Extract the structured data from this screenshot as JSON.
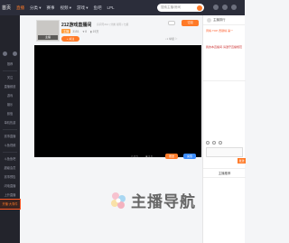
{
  "topbar": {
    "logo": "首页",
    "nav": [
      "直播",
      "分类 ▾",
      "赛事",
      "视频 ▾",
      "游戏 ▾",
      "鱼吧",
      "LPL"
    ],
    "search_placeholder": "搜索主播/房间"
  },
  "sidebar": {
    "items": [
      "推荐",
      "关注",
      "直播频道",
      "游戏",
      "娱乐",
      "颜值",
      "单机热游",
      "全部",
      "综合",
      "赛事直播",
      "斗鱼视频",
      "赛事中心",
      "明星直播"
    ],
    "bottom_items": [
      "斗鱼鱼吧",
      "超级会员",
      "赛事预告",
      "闪电直播",
      "上升直播",
      "鱼乐直播"
    ],
    "selected_label": "开播·大事件"
  },
  "room": {
    "avatar_caption": "主播",
    "title": "212游戏直播间",
    "meta": "房间号212 | 分类·星际 | 七级",
    "level_tag": "主播",
    "stats": [
      "3151",
      "♥ 8",
      "▮ 19万"
    ],
    "follow_label": "+ 关注",
    "subscribe_label": "订阅",
    "report": "↓1 举报 ⚐"
  },
  "giftbar": {
    "left_icons": [
      "◎ 8.5",
      "◉ 0.8"
    ],
    "btn_gift": "赠送",
    "btn_recharge": "充值"
  },
  "right_panel": {
    "header": "主播排行",
    "rank_text": "周榜·TOP·贡献榜·第一",
    "notice_text": "我的本直播间·请遵守直播规范",
    "send_label": "发送",
    "second_header": "主播推荐"
  },
  "watermark": {
    "text": "主播导航"
  },
  "colors": {
    "accent": "#ff7a28",
    "topbar": "#2b2d3a",
    "sidebar": "#23242c"
  }
}
